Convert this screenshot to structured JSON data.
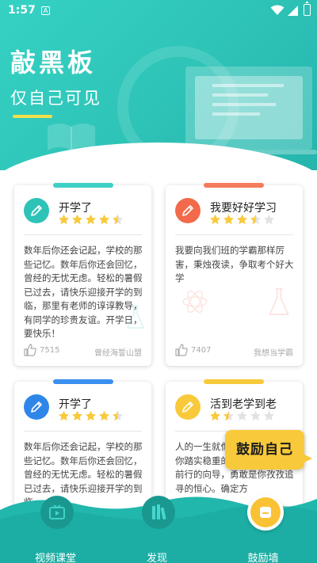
{
  "status_bar": {
    "time": "1:57",
    "notification_badge": "A"
  },
  "header": {
    "title": "敲黑板",
    "subtitle": "仅自己可见"
  },
  "cards": [
    {
      "title": "开学了",
      "rating": 4.5,
      "body": "数年后你还会记起，学校的那些记忆。数年后你还会回忆，曾经的无忧无虑。轻松的暑假已过去，请快乐迎接开学的到临，那里有老师的谆谆教导，有同学的珍贵友谊。开学日，要快乐！",
      "likes": "7515",
      "author": "曾经海誓山盟",
      "accent_color": "#2ec3b7",
      "tab_color": "#3fd0c5"
    },
    {
      "title": "我要好好学习",
      "rating": 3.5,
      "body": "我要向我们班的学霸那样厉害，秉烛夜读，争取考个好大学",
      "likes": "7407",
      "author": "我想当学霸",
      "accent_color": "#f26a4b",
      "tab_color": "#f47b5c"
    },
    {
      "title": "开学了",
      "rating": 4.5,
      "body": "数年后你还会记起，学校的那些记忆。数年后你还会回忆，曾经的无忧无虑。轻松的暑假已过去，请快乐迎接开学的到临",
      "accent_color": "#2f86e9",
      "tab_color": "#3a8ff0"
    },
    {
      "title": "活到老学到老",
      "rating": 1.5,
      "body": "人的一生就像一次旅行，奋是你踏实稳重的脚步，是你指引前行的向导，勇敢是你孜孜追寻的恒心。确定方",
      "accent_color": "#f8c93a",
      "tab_color": "#f8c93a"
    }
  ],
  "floating_tag": {
    "label": "鼓励自己"
  },
  "bottom_nav": {
    "items": [
      {
        "label": "视频课堂",
        "icon": "video-play-icon"
      },
      {
        "label": "发现",
        "icon": "books-icon"
      },
      {
        "label": "鼓励墙",
        "icon": "message-board-icon",
        "active": true
      }
    ]
  },
  "colors": {
    "header": "#2ec3b7",
    "nav": "#1fb3a8",
    "star": "#f8c93a",
    "star_empty": "#e2e2e2"
  }
}
